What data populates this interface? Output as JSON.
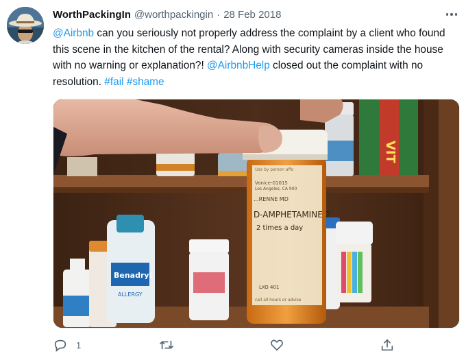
{
  "author": {
    "name": "WorthPackingIn",
    "handle": "@worthpackingin",
    "separator": "·",
    "date": "28 Feb 2018"
  },
  "tweet": {
    "segments": [
      {
        "text": "@Airbnb",
        "link": true
      },
      {
        "text": " can you seriously not properly address the complaint by a client who found this scene in the kitchen of the rental? Along with security cameras inside the house with no warning or explanation?! ",
        "link": false
      },
      {
        "text": "@AirbnbHelp",
        "link": true
      },
      {
        "text": " closed out the complaint with no resolution. ",
        "link": false
      },
      {
        "text": "#fail",
        "link": true
      },
      {
        "text": " ",
        "link": false
      },
      {
        "text": "#shame",
        "link": true
      }
    ]
  },
  "photo": {
    "label": {
      "line1": "Use by person affo",
      "line2": "Los Angeles, CA 900",
      "line3": "Vonice-01015",
      "line4": "Los Angeles, CA 900",
      "doctor": "...RENNE MD",
      "drug": "D-AMPHETAMINE 2",
      "sig": "2 times a day",
      "footer1": "LXO  401",
      "footer2": "call all hours or advise"
    },
    "benadryl": "Benadryl",
    "benadryl_sub": "ALLERGY",
    "box_text": "VIT"
  },
  "actions": {
    "reply_count": "1",
    "retweet_count": "",
    "like_count": ""
  },
  "colors": {
    "link": "#1d9bf0",
    "secondary": "#536471"
  }
}
